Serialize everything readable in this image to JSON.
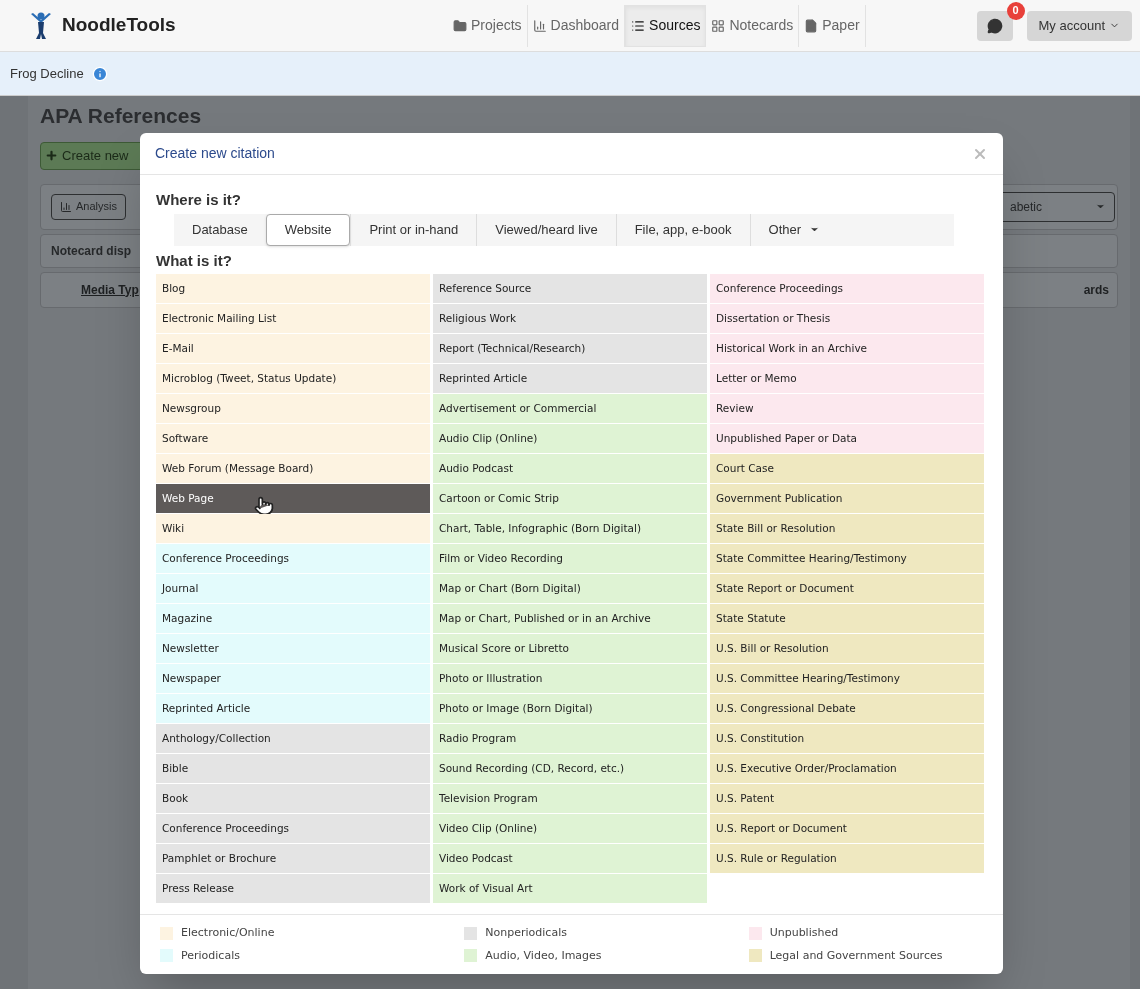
{
  "nav": {
    "brand": "NoodleTools",
    "items": [
      {
        "label": "Projects",
        "selected": false
      },
      {
        "label": "Dashboard",
        "selected": false
      },
      {
        "label": "Sources",
        "selected": true
      },
      {
        "label": "Notecards",
        "selected": false
      },
      {
        "label": "Paper",
        "selected": false
      }
    ],
    "messages_badge": "0",
    "account": "My account"
  },
  "breadcrumb": {
    "project": "Frog Decline"
  },
  "background": {
    "title": "APA References",
    "create_button": "Create new",
    "analysis_button": "Analysis",
    "notecard_label": "Notecard disp",
    "media_label": "Media Typ",
    "sort_select": "abetic",
    "cards_label": "ards"
  },
  "dialog": {
    "title": "Create new citation",
    "where_heading": "Where is it?",
    "where_tabs": [
      {
        "label": "Database",
        "selected": false
      },
      {
        "label": "Website",
        "selected": true
      },
      {
        "label": "Print or in-hand",
        "selected": false
      },
      {
        "label": "Viewed/heard live",
        "selected": false
      },
      {
        "label": "File, app, e-book",
        "selected": false
      },
      {
        "label": "Other",
        "selected": false,
        "dropdown": true
      }
    ],
    "what_heading": "What is it?",
    "columns": [
      [
        {
          "label": "Blog",
          "color": "#fdf3e1",
          "selected": false
        },
        {
          "label": "Electronic Mailing List",
          "color": "#fdf3e1",
          "selected": false
        },
        {
          "label": "E-Mail",
          "color": "#fdf3e1",
          "selected": false
        },
        {
          "label": "Microblog (Tweet, Status Update)",
          "color": "#fdf3e1",
          "selected": false
        },
        {
          "label": "Newsgroup",
          "color": "#fdf3e1",
          "selected": false
        },
        {
          "label": "Software",
          "color": "#fdf3e1",
          "selected": false
        },
        {
          "label": "Web Forum (Message Board)",
          "color": "#fdf3e1",
          "selected": false
        },
        {
          "label": "Web Page",
          "selected": true
        },
        {
          "label": "Wiki",
          "color": "#fdf3e1",
          "selected": false
        },
        {
          "label": "Conference Proceedings",
          "color": "#e3fbfc",
          "selected": false
        },
        {
          "label": "Journal",
          "color": "#e3fbfc",
          "selected": false
        },
        {
          "label": "Magazine",
          "color": "#e3fbfc",
          "selected": false
        },
        {
          "label": "Newsletter",
          "color": "#e3fbfc",
          "selected": false
        },
        {
          "label": "Newspaper",
          "color": "#e3fbfc",
          "selected": false
        },
        {
          "label": "Reprinted Article",
          "color": "#e3fbfc",
          "selected": false
        },
        {
          "label": "Anthology/Collection",
          "color": "#e4e4e4",
          "selected": false
        },
        {
          "label": "Bible",
          "color": "#e4e4e4",
          "selected": false
        },
        {
          "label": "Book",
          "color": "#e4e4e4",
          "selected": false
        },
        {
          "label": "Conference Proceedings",
          "color": "#e4e4e4",
          "selected": false
        },
        {
          "label": "Pamphlet or Brochure",
          "color": "#e4e4e4",
          "selected": false
        },
        {
          "label": "Press Release",
          "color": "#e4e4e4",
          "selected": false
        }
      ],
      [
        {
          "label": "Reference Source",
          "color": "#e4e4e4",
          "selected": false
        },
        {
          "label": "Religious Work",
          "color": "#e4e4e4",
          "selected": false
        },
        {
          "label": "Report (Technical/Research)",
          "color": "#e4e4e4",
          "selected": false
        },
        {
          "label": "Reprinted Article",
          "color": "#e4e4e4",
          "selected": false
        },
        {
          "label": "Advertisement or Commercial",
          "color": "#dff3d4",
          "selected": false
        },
        {
          "label": "Audio Clip (Online)",
          "color": "#dff3d4",
          "selected": false
        },
        {
          "label": "Audio Podcast",
          "color": "#dff3d4",
          "selected": false
        },
        {
          "label": "Cartoon or Comic Strip",
          "color": "#dff3d4",
          "selected": false
        },
        {
          "label": "Chart, Table, Infographic (Born Digital)",
          "color": "#dff3d4",
          "selected": false
        },
        {
          "label": "Film or Video Recording",
          "color": "#dff3d4",
          "selected": false
        },
        {
          "label": "Map or Chart (Born Digital)",
          "color": "#dff3d4",
          "selected": false
        },
        {
          "label": "Map or Chart, Published or in an Archive",
          "color": "#dff3d4",
          "selected": false
        },
        {
          "label": "Musical Score or Libretto",
          "color": "#dff3d4",
          "selected": false
        },
        {
          "label": "Photo or Illustration",
          "color": "#dff3d4",
          "selected": false
        },
        {
          "label": "Photo or Image (Born Digital)",
          "color": "#dff3d4",
          "selected": false
        },
        {
          "label": "Radio Program",
          "color": "#dff3d4",
          "selected": false
        },
        {
          "label": "Sound Recording (CD, Record, etc.)",
          "color": "#dff3d4",
          "selected": false
        },
        {
          "label": "Television Program",
          "color": "#dff3d4",
          "selected": false
        },
        {
          "label": "Video Clip (Online)",
          "color": "#dff3d4",
          "selected": false
        },
        {
          "label": "Video Podcast",
          "color": "#dff3d4",
          "selected": false
        },
        {
          "label": "Work of Visual Art",
          "color": "#dff3d4",
          "selected": false
        }
      ],
      [
        {
          "label": "Conference Proceedings",
          "color": "#fce8ee",
          "selected": false
        },
        {
          "label": "Dissertation or Thesis",
          "color": "#fce8ee",
          "selected": false
        },
        {
          "label": "Historical Work in an Archive",
          "color": "#fce8ee",
          "selected": false
        },
        {
          "label": "Letter or Memo",
          "color": "#fce8ee",
          "selected": false
        },
        {
          "label": "Review",
          "color": "#fce8ee",
          "selected": false
        },
        {
          "label": "Unpublished Paper or Data",
          "color": "#fce8ee",
          "selected": false
        },
        {
          "label": "Court Case",
          "color": "#efe8c0",
          "selected": false
        },
        {
          "label": "Government Publication",
          "color": "#efe8c0",
          "selected": false
        },
        {
          "label": "State Bill or Resolution",
          "color": "#efe8c0",
          "selected": false
        },
        {
          "label": "State Committee Hearing/Testimony",
          "color": "#efe8c0",
          "selected": false
        },
        {
          "label": "State Report or Document",
          "color": "#efe8c0",
          "selected": false
        },
        {
          "label": "State Statute",
          "color": "#efe8c0",
          "selected": false
        },
        {
          "label": "U.S. Bill or Resolution",
          "color": "#efe8c0",
          "selected": false
        },
        {
          "label": "U.S. Committee Hearing/Testimony",
          "color": "#efe8c0",
          "selected": false
        },
        {
          "label": "U.S. Congressional Debate",
          "color": "#efe8c0",
          "selected": false
        },
        {
          "label": "U.S. Constitution",
          "color": "#efe8c0",
          "selected": false
        },
        {
          "label": "U.S. Executive Order/Proclamation",
          "color": "#efe8c0",
          "selected": false
        },
        {
          "label": "U.S. Patent",
          "color": "#efe8c0",
          "selected": false
        },
        {
          "label": "U.S. Report or Document",
          "color": "#efe8c0",
          "selected": false
        },
        {
          "label": "U.S. Rule or Regulation",
          "color": "#efe8c0",
          "selected": false
        }
      ]
    ],
    "legend": [
      {
        "label": "Electronic/Online",
        "color": "#fdf3e1"
      },
      {
        "label": "Nonperiodicals",
        "color": "#e4e4e4"
      },
      {
        "label": "Unpublished",
        "color": "#fce8ee"
      },
      {
        "label": "Periodicals",
        "color": "#e3fbfc"
      },
      {
        "label": "Audio, Video, Images",
        "color": "#dff3d4"
      },
      {
        "label": "Legal and Government Sources",
        "color": "#efe8c0"
      }
    ]
  }
}
